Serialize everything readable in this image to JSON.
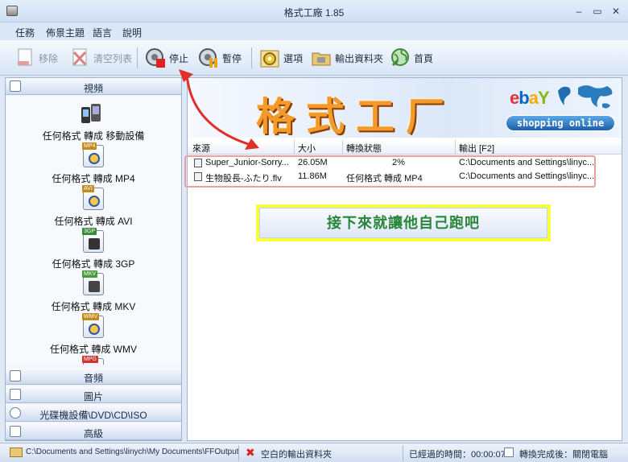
{
  "window": {
    "title": "格式工廠 1.85"
  },
  "menu": [
    "任務",
    "佈景主題",
    "語言",
    "說明"
  ],
  "toolbar": {
    "remove": "移除",
    "clear": "清空列表",
    "stop": "停止",
    "pause": "暫停",
    "options": "選項",
    "output_folder": "輸出資料夾",
    "home": "首頁"
  },
  "sidebar": {
    "video_section": "視頻",
    "items": [
      {
        "label": "任何格式 轉成 移動設備",
        "tag": ""
      },
      {
        "label": "任何格式 轉成 MP4",
        "tag": "MP4"
      },
      {
        "label": "任何格式 轉成 AVI",
        "tag": "AVI"
      },
      {
        "label": "任何格式 轉成 3GP",
        "tag": "3GP"
      },
      {
        "label": "任何格式 轉成 MKV",
        "tag": "MKV"
      },
      {
        "label": "任何格式 轉成 WMV",
        "tag": "WMV"
      },
      {
        "label": "",
        "tag": "MPG"
      }
    ],
    "audio_section": "音頻",
    "image_section": "圖片",
    "rom_section": "光碟機設備\\DVD\\CD\\ISO",
    "advanced_section": "高級"
  },
  "banner": {
    "title": "格式工厂",
    "ebay": [
      "e",
      "b",
      "a",
      "Y"
    ],
    "shop": "shopping online"
  },
  "table": {
    "headers": [
      "來源",
      "大小",
      "轉換狀態",
      "輸出 [F2]"
    ],
    "rows": [
      {
        "source": "Super_Junior-Sorry...",
        "size": "26.05M",
        "status": "2%",
        "output": "C:\\Documents and Settings\\linyc..."
      },
      {
        "source": "生物股長-ふたり.flv",
        "size": "11.86M",
        "status": "任何格式 轉成 MP4",
        "output": "C:\\Documents and Settings\\linyc..."
      }
    ]
  },
  "note": "接下來就讓他自己跑吧",
  "status": {
    "path": "C:\\Documents and Settings\\linych\\My Documents\\FFOutput",
    "empty_output": "空白的輸出資料夾",
    "elapsed": "已經過的時間：00:00:07",
    "after": "轉換完成後：關閉電腦"
  },
  "colors": {
    "accent": "#f39a2b",
    "note_bg": "#f4ff40",
    "note_text": "#27853c",
    "arrow": "#e0302a"
  }
}
